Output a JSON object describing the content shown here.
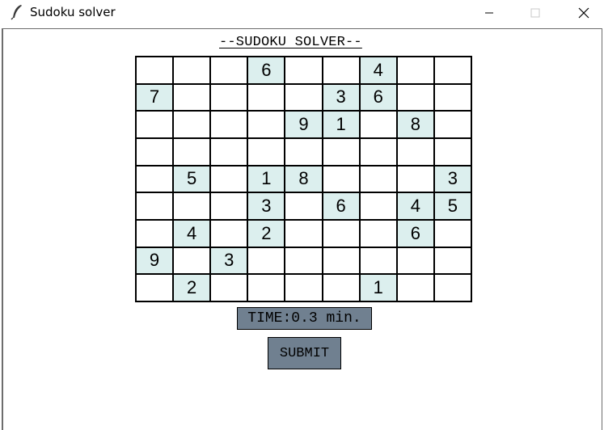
{
  "window": {
    "title": "Sudoku solver",
    "icon": "feather-icon",
    "controls": [
      "minimize-icon",
      "maximize-icon",
      "close-icon"
    ]
  },
  "heading": "--SUDOKU SOLVER--",
  "board": {
    "rows": [
      [
        "",
        "",
        "",
        "6",
        "",
        "",
        "4",
        "",
        ""
      ],
      [
        "7",
        "",
        "",
        "",
        "",
        "3",
        "6",
        "",
        ""
      ],
      [
        "",
        "",
        "",
        "",
        "9",
        "1",
        "",
        "8",
        ""
      ],
      [
        "",
        "",
        "",
        "",
        "",
        "",
        "",
        "",
        ""
      ],
      [
        "",
        "5",
        "",
        "1",
        "8",
        "",
        "",
        "",
        "3"
      ],
      [
        "",
        "",
        "",
        "3",
        "",
        "6",
        "",
        "4",
        "5"
      ],
      [
        "",
        "4",
        "",
        "2",
        "",
        "",
        "",
        "6",
        ""
      ],
      [
        "9",
        "",
        "3",
        "",
        "",
        "",
        "",
        "",
        ""
      ],
      [
        "",
        "2",
        "",
        "",
        "",
        "",
        "1",
        "",
        ""
      ]
    ]
  },
  "timer": "TIME:0.3 min.",
  "submit_label": "SUBMIT",
  "colors": {
    "given_cell": "#dcefee",
    "button": "#708090"
  }
}
